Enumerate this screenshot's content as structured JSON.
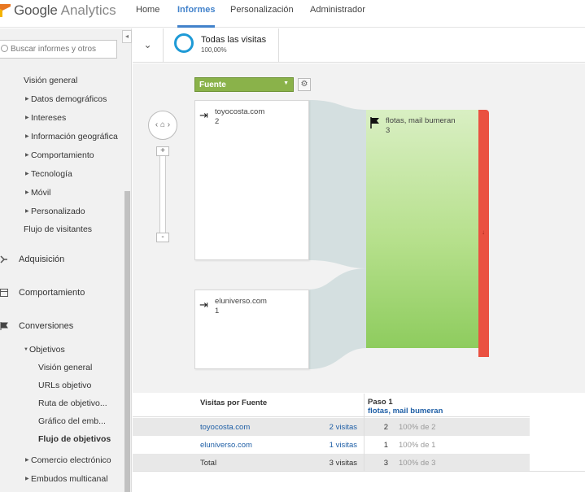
{
  "app": {
    "brand_google": "Google",
    "brand_product": "Analytics"
  },
  "nav": {
    "home": "Home",
    "reports": "Informes",
    "customization": "Personalización",
    "admin": "Administrador"
  },
  "sidebar": {
    "search_placeholder": "Buscar informes y otros",
    "items": [
      {
        "label": "Visión general"
      },
      {
        "label": "Datos demográficos"
      },
      {
        "label": "Intereses"
      },
      {
        "label": "Información geográfica"
      },
      {
        "label": "Comportamiento"
      },
      {
        "label": "Tecnología"
      },
      {
        "label": "Móvil"
      },
      {
        "label": "Personalizado"
      },
      {
        "label": "Flujo de visitantes"
      },
      {
        "label": "Adquisición"
      },
      {
        "label": "Comportamiento"
      },
      {
        "label": "Conversiones"
      },
      {
        "label": "Objetivos"
      },
      {
        "label": "Visión general"
      },
      {
        "label": "URLs objetivo"
      },
      {
        "label": "Ruta de objetivo..."
      },
      {
        "label": "Gráfico del emb..."
      },
      {
        "label": "Flujo de objetivos"
      },
      {
        "label": "Comercio electrónico"
      },
      {
        "label": "Embudos multicanal"
      }
    ]
  },
  "segment": {
    "name": "Todas las visitas",
    "percent": "100,00%",
    "color": "#1e9ad6"
  },
  "flow": {
    "dimension": "Fuente",
    "sources": [
      {
        "name": "toyocosta.com",
        "count": "2"
      },
      {
        "name": "eluniverso.com",
        "count": "1"
      }
    ],
    "goal": {
      "name": "flotas, mail bumeran",
      "count": "3",
      "exit_marker": "↓"
    },
    "zoom_in": "+",
    "zoom_out": "-",
    "colors": {
      "goal": "#9cd46b",
      "exit": "#ea5141",
      "dimension": "#8ab24a"
    }
  },
  "table": {
    "header_col1": "Visitas por Fuente",
    "header_step": "Paso 1",
    "header_goal": "flotas, mail bumeran",
    "rows": [
      {
        "source": "toyocosta.com",
        "visits": "2 visitas",
        "count": "2",
        "pct": "100% de 2"
      },
      {
        "source": "eluniverso.com",
        "visits": "1 visitas",
        "count": "1",
        "pct": "100% de 1"
      },
      {
        "source": "Total",
        "visits": "3 visitas",
        "count": "3",
        "pct": "100% de 3"
      }
    ]
  }
}
